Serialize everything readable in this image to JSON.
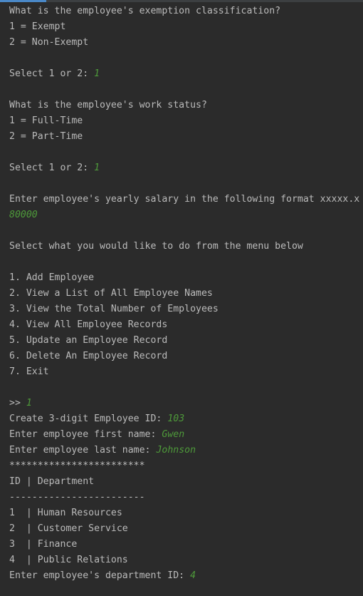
{
  "console": {
    "lines": [
      {
        "text": "What is the employee's exemption classification?",
        "input": ""
      },
      {
        "text": "1 = Exempt",
        "input": ""
      },
      {
        "text": "2 = Non-Exempt",
        "input": ""
      },
      {
        "text": "",
        "input": ""
      },
      {
        "text": "Select 1 or 2: ",
        "input": "1"
      },
      {
        "text": "",
        "input": ""
      },
      {
        "text": "What is the employee's work status?",
        "input": ""
      },
      {
        "text": "1 = Full-Time",
        "input": ""
      },
      {
        "text": "2 = Part-Time",
        "input": ""
      },
      {
        "text": "",
        "input": ""
      },
      {
        "text": "Select 1 or 2: ",
        "input": "1"
      },
      {
        "text": "",
        "input": ""
      },
      {
        "text": "Enter employee's yearly salary in the following format xxxxx.x",
        "input": ""
      },
      {
        "text": "",
        "input": "80000"
      },
      {
        "text": "",
        "input": ""
      },
      {
        "text": "Select what you would like to do from the menu below",
        "input": ""
      },
      {
        "text": "",
        "input": ""
      },
      {
        "text": "1. Add Employee",
        "input": ""
      },
      {
        "text": "2. View a List of All Employee Names",
        "input": ""
      },
      {
        "text": "3. View the Total Number of Employees",
        "input": ""
      },
      {
        "text": "4. View All Employee Records",
        "input": ""
      },
      {
        "text": "5. Update an Employee Record",
        "input": ""
      },
      {
        "text": "6. Delete An Employee Record",
        "input": ""
      },
      {
        "text": "7. Exit",
        "input": ""
      },
      {
        "text": "",
        "input": ""
      },
      {
        "text": ">> ",
        "input": "1"
      },
      {
        "text": "Create 3-digit Employee ID: ",
        "input": "103"
      },
      {
        "text": "Enter employee first name: ",
        "input": "Gwen"
      },
      {
        "text": "Enter employee last name: ",
        "input": "Johnson"
      },
      {
        "text": "************************",
        "input": ""
      },
      {
        "text": "ID | Department",
        "input": ""
      },
      {
        "text": "------------------------",
        "input": ""
      },
      {
        "text": "1  | Human Resources",
        "input": ""
      },
      {
        "text": "2  | Customer Service",
        "input": ""
      },
      {
        "text": "3  | Finance",
        "input": ""
      },
      {
        "text": "4  | Public Relations",
        "input": ""
      },
      {
        "text": "Enter employee's department ID: ",
        "input": "4"
      }
    ]
  },
  "colors": {
    "background": "#2b2b2b",
    "text": "#bbbbbb",
    "user_input": "#4e9a3a",
    "tab_accent": "#4a88c7"
  }
}
